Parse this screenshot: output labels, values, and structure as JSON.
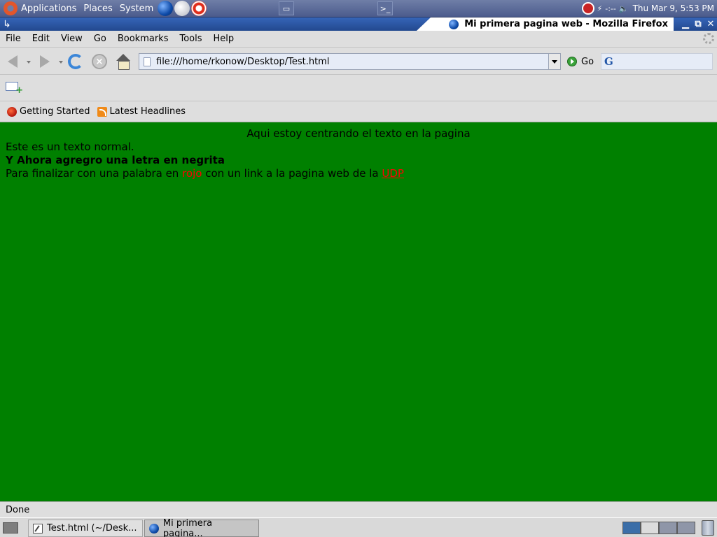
{
  "top_panel": {
    "applications_label": "Applications",
    "places_label": "Places",
    "system_label": "System",
    "tray_text": "-:--",
    "clock": "Thu Mar  9,  5:53 PM"
  },
  "window": {
    "title": "Mi primera pagina web - Mozilla Firefox"
  },
  "menubar": {
    "file": "File",
    "edit": "Edit",
    "view": "View",
    "go": "Go",
    "bookmarks": "Bookmarks",
    "tools": "Tools",
    "help": "Help"
  },
  "navbar": {
    "url": "file:///home/rkonow/Desktop/Test.html",
    "go_label": "Go"
  },
  "bookmarks_toolbar": {
    "items": [
      {
        "label": "Getting Started"
      },
      {
        "label": "Latest Headlines"
      }
    ]
  },
  "content": {
    "centered_text": "Aqui estoy centrando el texto en la pagina",
    "normal_text": "Este es un texto normal.",
    "bold_text": "Y Ahora agregro una letra en negrita",
    "final_prefix": "Para finalizar con una palabra en ",
    "red_word": "rojo",
    "final_middle": " con un link a la pagina web de la ",
    "link_text": "UDP"
  },
  "statusbar": {
    "text": "Done"
  },
  "taskbar": {
    "tasks": [
      {
        "label": "Test.html (~/Desk..."
      },
      {
        "label": "Mi primera pagina..."
      }
    ]
  },
  "colors": {
    "page_background": "#008000",
    "red_text": "#ff0000",
    "titlebar": "#2a55a3"
  }
}
